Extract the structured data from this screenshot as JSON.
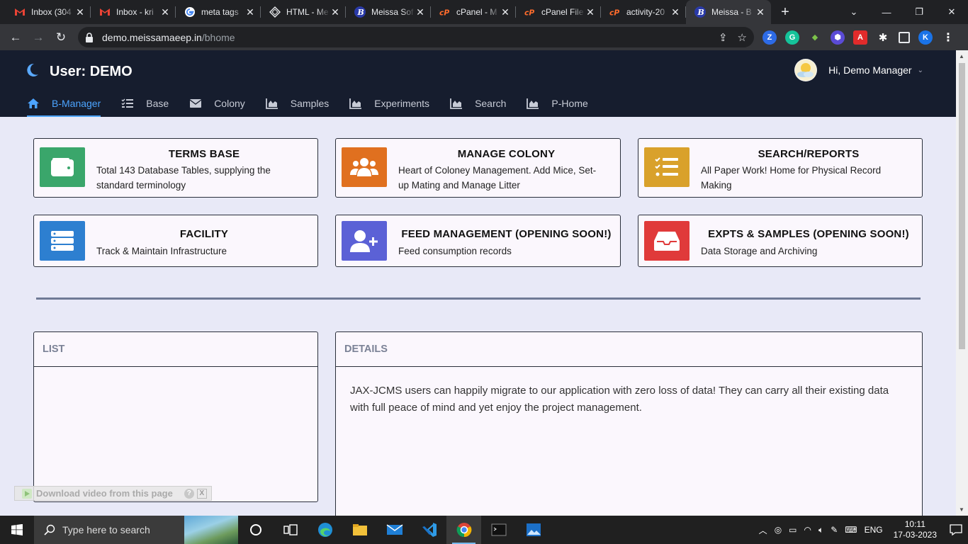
{
  "browser": {
    "tabs": [
      {
        "label": "Inbox (304",
        "icon": "gmail-icon",
        "active": false
      },
      {
        "label": "Inbox - kri",
        "icon": "gmail-icon",
        "active": false
      },
      {
        "label": "meta tags",
        "icon": "google-icon",
        "active": false
      },
      {
        "label": "HTML - Me",
        "icon": "web-icon",
        "active": false
      },
      {
        "label": "Meissa Sof",
        "icon": "meissa-icon",
        "active": false
      },
      {
        "label": "cPanel - M",
        "icon": "cpanel-icon",
        "active": false
      },
      {
        "label": "cPanel File",
        "icon": "cpanel-icon",
        "active": false
      },
      {
        "label": "activity-20",
        "icon": "cpanel-icon",
        "active": false
      },
      {
        "label": "Meissa - B",
        "icon": "meissa-icon",
        "active": true
      }
    ],
    "url_host": "demo.meissamaeep.in",
    "url_path": "/bhome",
    "profile_initial": "K",
    "colors": {
      "chrome_dark": "#202124",
      "chrome_mid": "#35363a"
    }
  },
  "app": {
    "title": "User: DEMO",
    "greeting": "Hi, Demo Manager",
    "nav": [
      {
        "label": "B-Manager",
        "icon": "home-icon",
        "active": true
      },
      {
        "label": "Base",
        "icon": "list-check-icon",
        "active": false
      },
      {
        "label": "Colony",
        "icon": "envelope-icon",
        "active": false
      },
      {
        "label": "Samples",
        "icon": "area-chart-icon",
        "active": false
      },
      {
        "label": "Experiments",
        "icon": "area-chart-icon",
        "active": false
      },
      {
        "label": "Search",
        "icon": "area-chart-icon",
        "active": false
      },
      {
        "label": "P-Home",
        "icon": "area-chart-icon",
        "active": false
      }
    ],
    "colors": {
      "header": "#161d2e",
      "nav_active": "#4ca4ff",
      "page_bg": "#e8e9f7"
    }
  },
  "cards": [
    {
      "title": "TERMS BASE",
      "desc": "Total 143 Database Tables, supplying the standard terminology",
      "icon": "wallet-icon",
      "color": "#3aa66b"
    },
    {
      "title": "MANAGE COLONY",
      "desc": "Heart of Coloney Management. Add Mice, Set-up Mating and Manage Litter",
      "icon": "users-icon",
      "color": "#e0701f"
    },
    {
      "title": "SEARCH/REPORTS",
      "desc": "All Paper Work! Home for Physical Record Making",
      "icon": "task-list-icon",
      "color": "#d9a12b"
    },
    {
      "title": "FACILITY",
      "desc": "Track & Maintain Infrastructure",
      "icon": "server-icon",
      "color": "#2d7fd0"
    },
    {
      "title": "FEED MANAGEMENT (OPENING SOON!)",
      "desc": "Feed consumption records",
      "icon": "user-plus-icon",
      "color": "#5b61d6"
    },
    {
      "title": "EXPTS & SAMPLES (OPENING SOON!)",
      "desc": "Data Storage and Archiving",
      "icon": "inbox-icon",
      "color": "#e03a3a"
    }
  ],
  "list_panel": {
    "title": "LIST"
  },
  "details_panel": {
    "title": "DETAILS",
    "text": "JAX-JCMS users can happily migrate to our application with zero loss of data! They can carry all their existing data with full peace of mind and yet enjoy the project management."
  },
  "download_bar": {
    "label": "Download video from this page",
    "help": "?",
    "close": "X"
  },
  "taskbar": {
    "search_placeholder": "Type here to search",
    "language": "ENG",
    "time": "10:11",
    "date": "17-03-2023"
  }
}
